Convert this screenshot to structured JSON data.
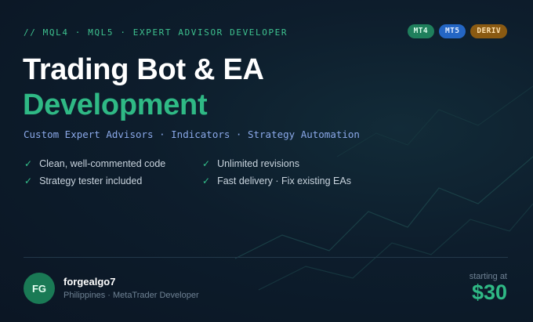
{
  "header": {
    "eyebrow": "// MQL4 · MQL5 · EXPERT ADVISOR DEVELOPER",
    "badges": [
      "MT4",
      "MT5",
      "DERIV"
    ]
  },
  "hero": {
    "title_line1": "Trading Bot & EA",
    "title_line2": "Development",
    "subtitle": "Custom Expert Advisors · Indicators · Strategy Automation"
  },
  "features": [
    "Clean, well-commented code",
    "Unlimited revisions",
    "Strategy tester included",
    "Fast delivery · Fix existing EAs"
  ],
  "profile": {
    "initials": "FG",
    "username": "forgealgo7",
    "subtitle": "Philippines · MetaTrader Developer"
  },
  "pricing": {
    "label": "starting at",
    "price": "$30"
  },
  "colors": {
    "accent": "#2fb985",
    "mt4": "#1f7f5c",
    "mt5": "#2466c4",
    "deriv": "#8a5a12"
  }
}
